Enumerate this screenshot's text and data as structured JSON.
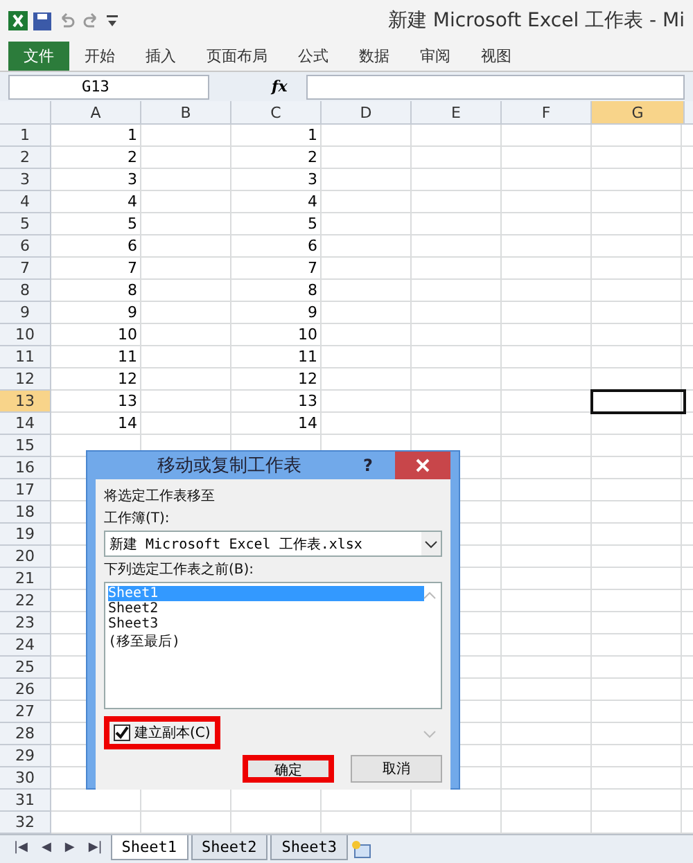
{
  "title_bar": {
    "title": "新建 Microsoft Excel 工作表 - Mi"
  },
  "ribbon_tabs": [
    {
      "label": "文件",
      "kind": "file"
    },
    {
      "label": "开始",
      "kind": "tab"
    },
    {
      "label": "插入",
      "kind": "tab"
    },
    {
      "label": "页面布局",
      "kind": "tab"
    },
    {
      "label": "公式",
      "kind": "tab"
    },
    {
      "label": "数据",
      "kind": "tab"
    },
    {
      "label": "审阅",
      "kind": "tab"
    },
    {
      "label": "视图",
      "kind": "tab"
    }
  ],
  "formula_bar": {
    "name_box": "G13",
    "fx": "fx"
  },
  "columns": [
    {
      "label": "A",
      "selected": false
    },
    {
      "label": "B",
      "selected": false
    },
    {
      "label": "C",
      "selected": false
    },
    {
      "label": "D",
      "selected": false
    },
    {
      "label": "E",
      "selected": false
    },
    {
      "label": "F",
      "selected": false
    },
    {
      "label": "G",
      "selected": true
    }
  ],
  "rows": [
    {
      "label": "1",
      "selected": false,
      "column_a": "1",
      "column_c": "1"
    },
    {
      "label": "2",
      "selected": false,
      "column_a": "2",
      "column_c": "2"
    },
    {
      "label": "3",
      "selected": false,
      "column_a": "3",
      "column_c": "3"
    },
    {
      "label": "4",
      "selected": false,
      "column_a": "4",
      "column_c": "4"
    },
    {
      "label": "5",
      "selected": false,
      "column_a": "5",
      "column_c": "5"
    },
    {
      "label": "6",
      "selected": false,
      "column_a": "6",
      "column_c": "6"
    },
    {
      "label": "7",
      "selected": false,
      "column_a": "7",
      "column_c": "7"
    },
    {
      "label": "8",
      "selected": false,
      "column_a": "8",
      "column_c": "8"
    },
    {
      "label": "9",
      "selected": false,
      "column_a": "9",
      "column_c": "9"
    },
    {
      "label": "10",
      "selected": false,
      "column_a": "10",
      "column_c": "10"
    },
    {
      "label": "11",
      "selected": false,
      "column_a": "11",
      "column_c": "11"
    },
    {
      "label": "12",
      "selected": false,
      "column_a": "12",
      "column_c": "12"
    },
    {
      "label": "13",
      "selected": true,
      "column_a": "13",
      "column_c": "13"
    },
    {
      "label": "14",
      "selected": false,
      "column_a": "14",
      "column_c": "14"
    },
    {
      "label": "15",
      "selected": false
    },
    {
      "label": "16",
      "selected": false
    },
    {
      "label": "17",
      "selected": false
    },
    {
      "label": "18",
      "selected": false
    },
    {
      "label": "19",
      "selected": false
    },
    {
      "label": "20",
      "selected": false
    },
    {
      "label": "21",
      "selected": false
    },
    {
      "label": "22",
      "selected": false
    },
    {
      "label": "23",
      "selected": false
    },
    {
      "label": "24",
      "selected": false
    },
    {
      "label": "25",
      "selected": false
    },
    {
      "label": "26",
      "selected": false
    },
    {
      "label": "27",
      "selected": false
    },
    {
      "label": "28",
      "selected": false
    },
    {
      "label": "29",
      "selected": false
    },
    {
      "label": "30",
      "selected": false
    },
    {
      "label": "31",
      "selected": false
    },
    {
      "label": "32",
      "selected": false
    }
  ],
  "dialog": {
    "title": "移动或复制工作表",
    "help": "?",
    "move_to_label": "将选定工作表移至",
    "workbook_label": "工作簿(T):",
    "workbook_value": "新建 Microsoft Excel 工作表.xlsx",
    "before_label": "下列选定工作表之前(B):",
    "sheets": [
      {
        "label": "Sheet1",
        "selected": true
      },
      {
        "label": "Sheet2",
        "selected": false
      },
      {
        "label": "Sheet3",
        "selected": false
      },
      {
        "label": "(移至最后)",
        "selected": false
      }
    ],
    "copy_checkbox": {
      "label": "建立副本(C)",
      "checked": true,
      "highlighted": true
    },
    "buttons": [
      {
        "label": "确定",
        "highlighted": true
      },
      {
        "label": "取消",
        "highlighted": false
      }
    ]
  },
  "sheet_nav": [
    "|◀",
    "◀",
    "▶",
    "▶|"
  ],
  "sheet_tabs": [
    {
      "label": "Sheet1",
      "selected": true
    },
    {
      "label": "Sheet2",
      "selected": false
    },
    {
      "label": "Sheet3",
      "selected": false
    }
  ]
}
